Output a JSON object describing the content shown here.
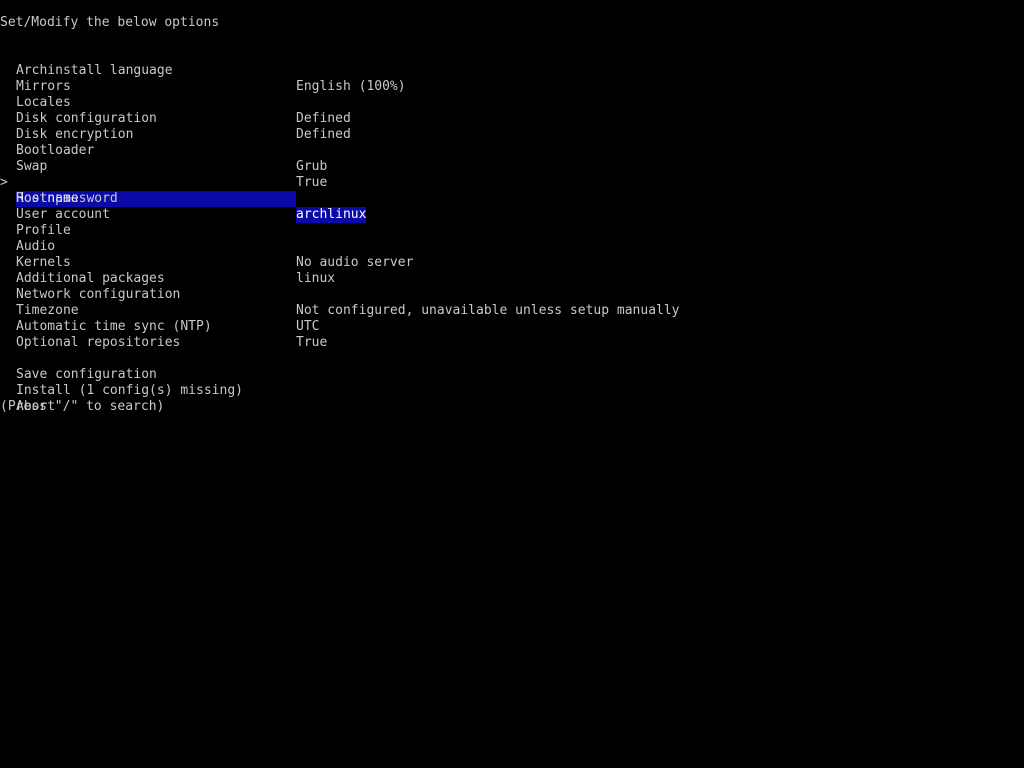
{
  "header": {
    "title": "Set/Modify the below options"
  },
  "menu": {
    "cursor_symbol": ">",
    "items": [
      {
        "label": "Archinstall language",
        "value": "English (100%)"
      },
      {
        "label": "Mirrors",
        "value": ""
      },
      {
        "label": "Locales",
        "value": "Defined"
      },
      {
        "label": "Disk configuration",
        "value": "Defined"
      },
      {
        "label": "Disk encryption",
        "value": ""
      },
      {
        "label": "Bootloader",
        "value": "Grub"
      },
      {
        "label": "Swap",
        "value": "True"
      },
      {
        "label": "Hostname",
        "value": "archlinux"
      },
      {
        "label": "Root password",
        "value": ""
      },
      {
        "label": "User account",
        "value": ""
      },
      {
        "label": "Profile",
        "value": ""
      },
      {
        "label": "Audio",
        "value": "No audio server"
      },
      {
        "label": "Kernels",
        "value": "linux"
      },
      {
        "label": "Additional packages",
        "value": ""
      },
      {
        "label": "Network configuration",
        "value": "Not configured, unavailable unless setup manually"
      },
      {
        "label": "Timezone",
        "value": "UTC"
      },
      {
        "label": "Automatic time sync (NTP)",
        "value": "True"
      },
      {
        "label": "Optional repositories",
        "value": ""
      }
    ],
    "actions": [
      {
        "label": "Save configuration"
      },
      {
        "label": "Install (1 config(s) missing)"
      },
      {
        "label": "Abort"
      }
    ]
  },
  "footer": {
    "hint": "(Press \"/\" to search)"
  },
  "colors": {
    "background": "#000000",
    "text": "#c8c8c8",
    "selection": "#0a0aa8"
  }
}
